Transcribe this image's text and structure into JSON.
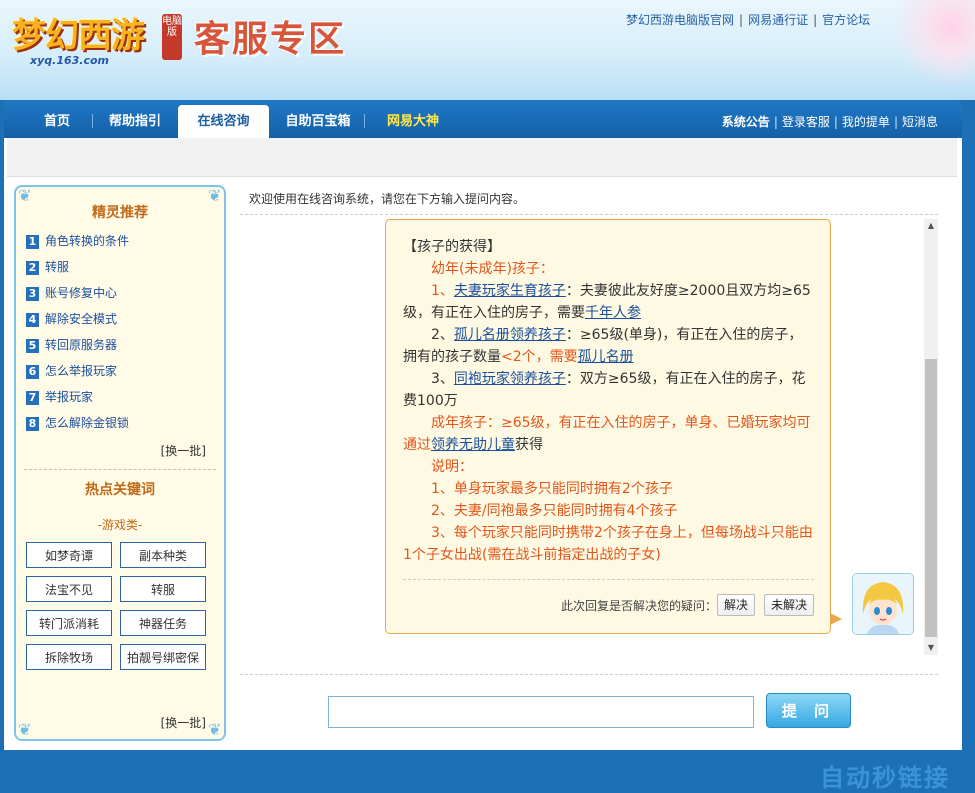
{
  "header": {
    "logo_text": "梦幻西游",
    "logo_tag": "电脑版",
    "logo_url": "xyq.163.com",
    "zone_title": "客服专区",
    "top_links": [
      "梦幻西游电脑版官网",
      "网易通行证",
      "官方论坛"
    ]
  },
  "nav": {
    "tabs": [
      {
        "label": "首页"
      },
      {
        "label": "帮助指引"
      },
      {
        "label": "在线咨询"
      },
      {
        "label": "自助百宝箱"
      },
      {
        "label": "网易大神"
      }
    ],
    "active_tab": "在线咨询",
    "right_links": [
      "系统公告",
      "登录客服",
      "我的提单",
      "短消息"
    ]
  },
  "sidebar": {
    "rec_title": "精灵推荐",
    "items": [
      {
        "num": "1",
        "label": "角色转换的条件"
      },
      {
        "num": "2",
        "label": "转服"
      },
      {
        "num": "3",
        "label": "账号修复中心"
      },
      {
        "num": "4",
        "label": "解除安全模式"
      },
      {
        "num": "5",
        "label": "转回原服务器"
      },
      {
        "num": "6",
        "label": "怎么举报玩家"
      },
      {
        "num": "7",
        "label": "举报玩家"
      },
      {
        "num": "8",
        "label": "怎么解除金银锁"
      }
    ],
    "swap_label": "[换一批]",
    "hot_title": "热点关键词",
    "category": "-游戏类-",
    "keywords": [
      "如梦奇谭",
      "副本种类",
      "法宝不见",
      "转服",
      "转门派消耗",
      "神器任务",
      "拆除牧场",
      "拍靓号绑密保"
    ],
    "swap_label_2": "[换一批]"
  },
  "main": {
    "welcome": "欢迎使用在线咨询系统，请您在下方输入提问内容。",
    "answer": {
      "heading": "【孩子的获得】",
      "young_title": "幼年(未成年)孩子：",
      "p1_prefix": "1、",
      "p1_link": "夫妻玩家生育孩子",
      "p1_text": "：夫妻彼此友好度≥2000且双方均≥65级，有正在入住的房子，需要",
      "p1_link2": "千年人参",
      "p2_prefix": "2、",
      "p2_link": "孤儿名册领养孩子",
      "p2_text": "：≥65级(单身)，有正在入住的房子，拥有的孩子数量",
      "p2_org": "<2个，需要",
      "p2_link2": "孤儿名册",
      "p3_prefix": "3、",
      "p3_link": "同袍玩家领养孩子",
      "p3_text": "：双方≥65级，有正在入住的房子，花费100万",
      "adult_text": "成年孩子：≥65级，有正在入住的房子，单身、已婚玩家均可通过",
      "adult_link": "领养无助儿童",
      "adult_suffix": "获得",
      "note_title": "说明：",
      "note1": "1、单身玩家最多只能同时拥有2个孩子",
      "note2": "2、夫妻/同袍最多只能同时拥有4个孩子",
      "note3": "3、每个玩家只能同时携带2个孩子在身上，但每场战斗只能由1个子女出战(需在战斗前指定出战的子女)"
    },
    "feedback_question": "此次回复是否解决您的疑问：",
    "resolved_label": "解决",
    "unresolved_label": "未解决",
    "question_input_value": "",
    "ask_button": "提 问"
  },
  "watermark": "自动秒链接"
}
